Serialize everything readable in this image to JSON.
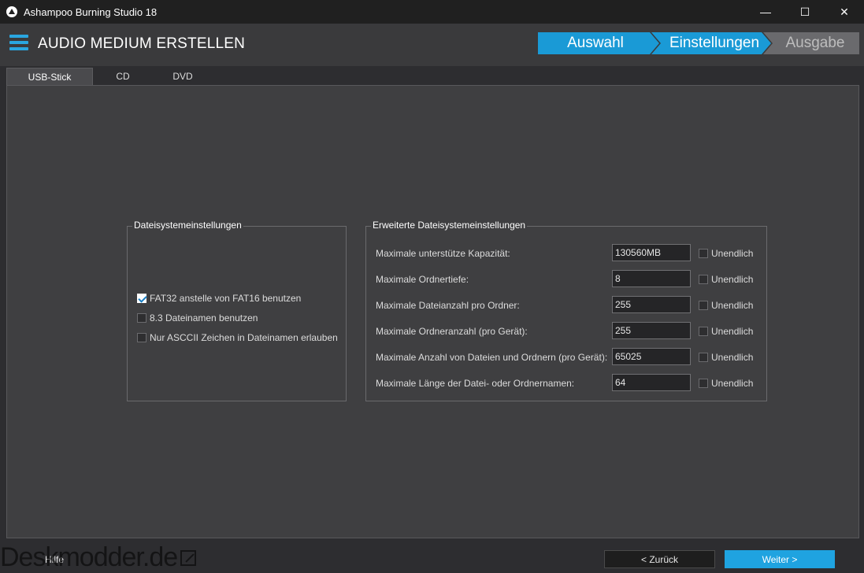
{
  "window": {
    "title": "Ashampoo Burning Studio 18",
    "controls": {
      "minimize": "—",
      "maximize": "☐",
      "close": "✕"
    }
  },
  "header": {
    "title": "AUDIO MEDIUM ERSTELLEN",
    "steps": [
      {
        "label": "Auswahl",
        "state": "done"
      },
      {
        "label": "Einstellungen",
        "state": "active"
      },
      {
        "label": "Ausgabe",
        "state": "pending"
      }
    ],
    "accent_color": "#1a9ad6"
  },
  "tabs": [
    {
      "label": "USB-Stick",
      "active": true
    },
    {
      "label": "CD",
      "active": false
    },
    {
      "label": "DVD",
      "active": false
    }
  ],
  "fs_settings": {
    "title": "Dateisystemeinstellungen",
    "options": [
      {
        "label": "FAT32 anstelle von FAT16 benutzen",
        "checked": true
      },
      {
        "label": "8.3 Dateinamen benutzen",
        "checked": false
      },
      {
        "label": "Nur ASCCII Zeichen in Dateinamen erlauben",
        "checked": false
      }
    ]
  },
  "advanced_settings": {
    "title": "Erweiterte Dateisystemeinstellungen",
    "unlimited_label": "Unendlich",
    "rows": [
      {
        "label": "Maximale unterstütze Kapazität:",
        "value": "130560MB",
        "unlimited": false
      },
      {
        "label": "Maximale Ordnertiefe:",
        "value": "8",
        "unlimited": false
      },
      {
        "label": "Maximale Dateianzahl pro Ordner:",
        "value": "255",
        "unlimited": false
      },
      {
        "label": "Maximale Ordneranzahl (pro Gerät):",
        "value": "255",
        "unlimited": false
      },
      {
        "label": "Maximale Anzahl von Dateien und Ordnern (pro Gerät):",
        "value": "65025",
        "unlimited": false
      },
      {
        "label": "Maximale Länge der Datei- oder Ordnernamen:",
        "value": "64",
        "unlimited": false
      }
    ]
  },
  "footer": {
    "help_label": "Hilfe",
    "back_label": "< Zurück",
    "next_label": "Weiter >"
  },
  "watermark": {
    "text": "Deskmodder.de"
  }
}
